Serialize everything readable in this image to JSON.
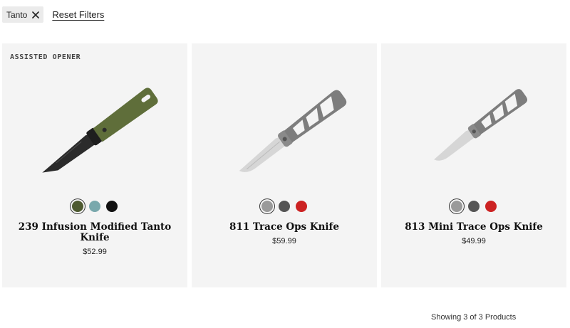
{
  "filters": {
    "active_chip": "Tanto",
    "reset_label": "Reset Filters"
  },
  "products": [
    {
      "badge": "ASSISTED OPENER",
      "name": "239 Infusion Modified Tanto Knife",
      "price": "$52.99",
      "handle_color": "#5f6e3a",
      "blade_color": "#2b2b2b",
      "swatches": [
        "#4e5a30",
        "#79a8ac",
        "#111111"
      ],
      "selected_swatch": 0
    },
    {
      "badge": "",
      "name": "811 Trace Ops Knife",
      "price": "$59.99",
      "handle_color": "#7d7d7d",
      "blade_color": "#cfcfcf",
      "swatches": [
        "#9a9a9a",
        "#555555",
        "#cc2222"
      ],
      "selected_swatch": 0
    },
    {
      "badge": "",
      "name": "813 Mini Trace Ops Knife",
      "price": "$49.99",
      "handle_color": "#7d7d7d",
      "blade_color": "#cfcfcf",
      "swatches": [
        "#9a9a9a",
        "#555555",
        "#cc2222"
      ],
      "selected_swatch": 0
    }
  ],
  "results_summary": "Showing 3 of 3 Products"
}
